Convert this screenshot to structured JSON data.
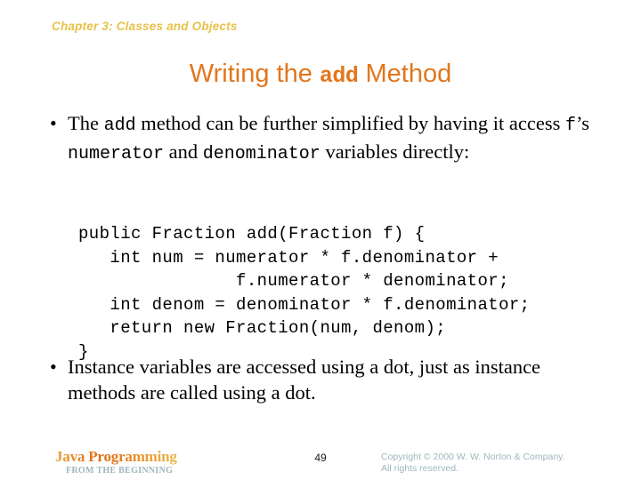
{
  "slide": {
    "chapter_header": "Chapter 3: Classes and Objects",
    "title": {
      "prefix": "Writing the ",
      "code": "add",
      "suffix": " Method"
    },
    "bullets": [
      {
        "marker": "•",
        "segments": [
          {
            "text": "The ",
            "style": "serif"
          },
          {
            "text": "add",
            "style": "mono"
          },
          {
            "text": " method can be further simplified by having it access ",
            "style": "serif"
          },
          {
            "text": "f",
            "style": "mono"
          },
          {
            "text": "’s ",
            "style": "serif"
          },
          {
            "text": "numerator",
            "style": "mono"
          },
          {
            "text": " and ",
            "style": "serif"
          },
          {
            "text": "denominator",
            "style": "mono"
          },
          {
            "text": " variables directly:",
            "style": "serif"
          }
        ]
      },
      {
        "marker": "•",
        "segments": [
          {
            "text": "Instance variables are accessed using a dot, just as instance methods are called using a dot.",
            "style": "serif"
          }
        ]
      }
    ],
    "code": "public Fraction add(Fraction f) {\n   int num = numerator * f.denominator +\n               f.numerator * denominator;\n   int denom = denominator * f.denominator;\n   return new Fraction(num, denom);\n}"
  },
  "footer": {
    "brand_title": "Java Programming",
    "brand_subtitle": "FROM THE BEGINNING",
    "page_number": "49",
    "copyright_line1": "Copyright © 2000 W. W. Norton & Company.",
    "copyright_line2": "All rights reserved."
  },
  "colors": {
    "chapter_header": "#e8c24b",
    "title": "#e2761c",
    "body_text": "#000000",
    "footer_muted": "#9db7bd",
    "background": "#ffffff"
  }
}
